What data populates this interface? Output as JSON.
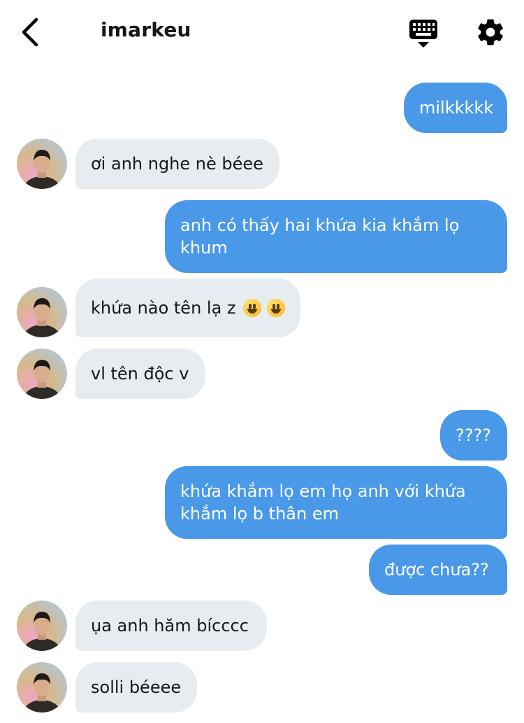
{
  "header": {
    "title": "imarkeu"
  },
  "messages": [
    {
      "side": "sent",
      "text": "milkkkkk"
    },
    {
      "side": "received",
      "text": "ơi anh nghe nè béee"
    },
    {
      "side": "sent",
      "line1": "anh có thấy hai khứa kia khắm lọ",
      "line2": "khum"
    },
    {
      "side": "received",
      "text": "khứa nào tên lạ z",
      "emoji": [
        "grinning-face",
        "grinning-face"
      ]
    },
    {
      "side": "received",
      "text": "vl tên độc v"
    },
    {
      "side": "sent",
      "text": "????"
    },
    {
      "side": "sent",
      "line1": "khứa khắm lọ em họ anh với khứa",
      "line2": "khắm lọ b thân em"
    },
    {
      "side": "sent",
      "text": "được chưa??"
    },
    {
      "side": "received",
      "text": "ụa anh hăm bícccc"
    },
    {
      "side": "received",
      "text": "solli béeee"
    }
  ],
  "colors": {
    "sent_bubble": "#4a99e9",
    "received_bubble": "#e6ecf0",
    "text_dark": "#14171a"
  },
  "icons": {
    "back": "chevron-left-icon",
    "keyboard": "keyboard-icon",
    "settings": "gear-icon",
    "avatar": "user-avatar"
  }
}
